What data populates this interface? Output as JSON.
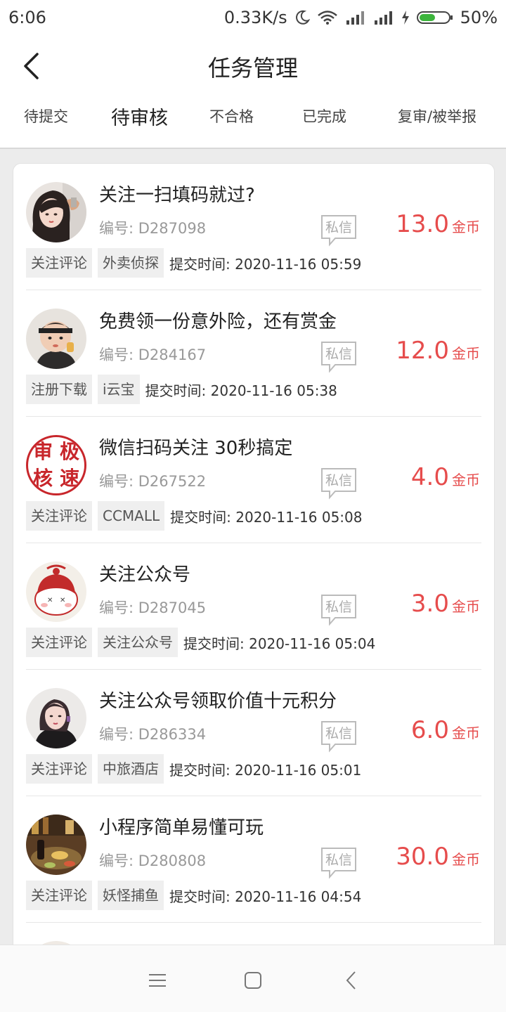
{
  "status_bar": {
    "time": "6:06",
    "network_speed": "0.33K/s",
    "battery": "50%"
  },
  "header": {
    "title": "任务管理"
  },
  "tabs": [
    {
      "label": "待提交",
      "active": false
    },
    {
      "label": "待审核",
      "active": true
    },
    {
      "label": "不合格",
      "active": false
    },
    {
      "label": "已完成",
      "active": false
    },
    {
      "label": "复审/被举报",
      "active": false
    }
  ],
  "common": {
    "message_label": "私信",
    "currency_unit": "金币"
  },
  "tasks": [
    {
      "title": "关注一扫填码就过?",
      "number": "编号: D287098",
      "amount": "13.0",
      "tags": [
        "关注评论",
        "外卖侦探"
      ],
      "submit_time": "提交时间: 2020-11-16 05:59",
      "avatar": "girl-portrait-avatar"
    },
    {
      "title": "免费领一份意外险，还有赏金",
      "number": "编号: D284167",
      "amount": "12.0",
      "tags": [
        "注册下载",
        "i云宝"
      ],
      "submit_time": "提交时间: 2020-11-16 05:38",
      "avatar": "baby-photo-avatar"
    },
    {
      "title": "微信扫码关注 30秒搞定",
      "number": "编号: D267522",
      "amount": "4.0",
      "tags": [
        "关注评论",
        "CCMALL"
      ],
      "submit_time": "提交时间: 2020-11-16 05:08",
      "avatar": "seal-avatar",
      "avatar_text": [
        "审",
        "极",
        "核",
        "速"
      ]
    },
    {
      "title": "关注公众号",
      "number": "编号: D287045",
      "amount": "3.0",
      "tags": [
        "关注评论",
        "关注公众号"
      ],
      "submit_time": "提交时间: 2020-11-16 05:04",
      "avatar": "cartoon-mascot-avatar"
    },
    {
      "title": "关注公众号领取价值十元积分",
      "number": "编号: D286334",
      "amount": "6.0",
      "tags": [
        "关注评论",
        "中旅酒店"
      ],
      "submit_time": "提交时间: 2020-11-16 05:01",
      "avatar": "woman-portrait-avatar"
    },
    {
      "title": "小程序简单易懂可玩",
      "number": "编号: D280808",
      "amount": "30.0",
      "tags": [
        "关注评论",
        "妖怪捕鱼"
      ],
      "submit_time": "提交时间: 2020-11-16 04:54",
      "avatar": "food-photo-avatar"
    }
  ],
  "colors": {
    "price": "#e64c4c",
    "background": "#ececec"
  }
}
